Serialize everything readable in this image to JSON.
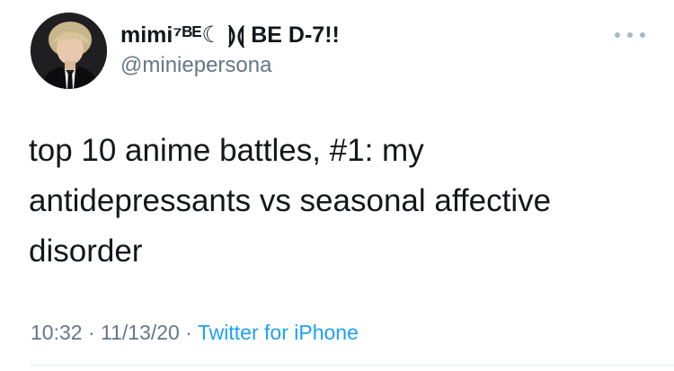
{
  "tweet": {
    "display_name": "mimi⁷ᴮᴱ☾ ⟭⟬ BE D-7!!",
    "handle": "@miniepersona",
    "text": "top 10 anime battles, #1: my antidepressants vs seasonal affective disorder",
    "time": "10:32",
    "date": "11/13/20",
    "separator": "·",
    "source": "Twitter for iPhone"
  },
  "icons": {
    "more": "more-options-icon",
    "avatar": "profile-avatar"
  },
  "colors": {
    "text": "#14171a",
    "secondary": "#657786",
    "link": "#1da1f2",
    "divider": "#e1e8ed"
  }
}
